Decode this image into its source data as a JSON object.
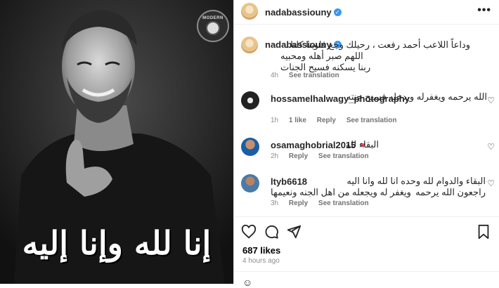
{
  "post": {
    "author": "nadabassiouny",
    "verified_mark": "✓",
    "more_label": "•••"
  },
  "media": {
    "watermark_text": "MODERN",
    "calligraphy_text": "إنا لله وإنا إليه راجعون"
  },
  "caption": {
    "username": "nadabassiouny",
    "lines": [
      "وداعاً اللاعب أحمد رفعت ، رحيلك وجع قلوبنا كلنا .",
      "اللهم صبر أهله ومحبيه",
      "ربنا يسكنه فسيح الجنات"
    ],
    "time": "4h",
    "see_translation": "See translation"
  },
  "comments": [
    {
      "username": "hossamelhalwagy_photography",
      "text": "الله يرحمه ويغفرله ويدخله فسيح جنته",
      "time": "1h",
      "likes": "1 like",
      "reply": "Reply",
      "see_translation": "See translation"
    },
    {
      "username": "osamaghobrial2015",
      "text": "البقاء لله",
      "heart_emoji": "♥",
      "time": "2h",
      "reply": "Reply",
      "see_translation": "See translation"
    },
    {
      "username": "ltyb6618",
      "text": "البقاء والدوام لله وحده انا لله وانا اليه راجعون الله يرحمه",
      "text2": "ويغفر له ويجعله من اهل الجنه ونعيمها",
      "time": "3h",
      "reply": "Reply",
      "see_translation": "See translation"
    }
  ],
  "actions": {
    "like_icon": "heart-icon",
    "comment_icon": "comment-icon",
    "share_icon": "share-icon",
    "save_icon": "bookmark-icon"
  },
  "stats": {
    "likes": "687 likes",
    "posted": "4 hours ago"
  },
  "colors": {
    "verified": "#3897f0",
    "heart_red": "#ed4956",
    "meta_gray": "#8e8e8e"
  }
}
